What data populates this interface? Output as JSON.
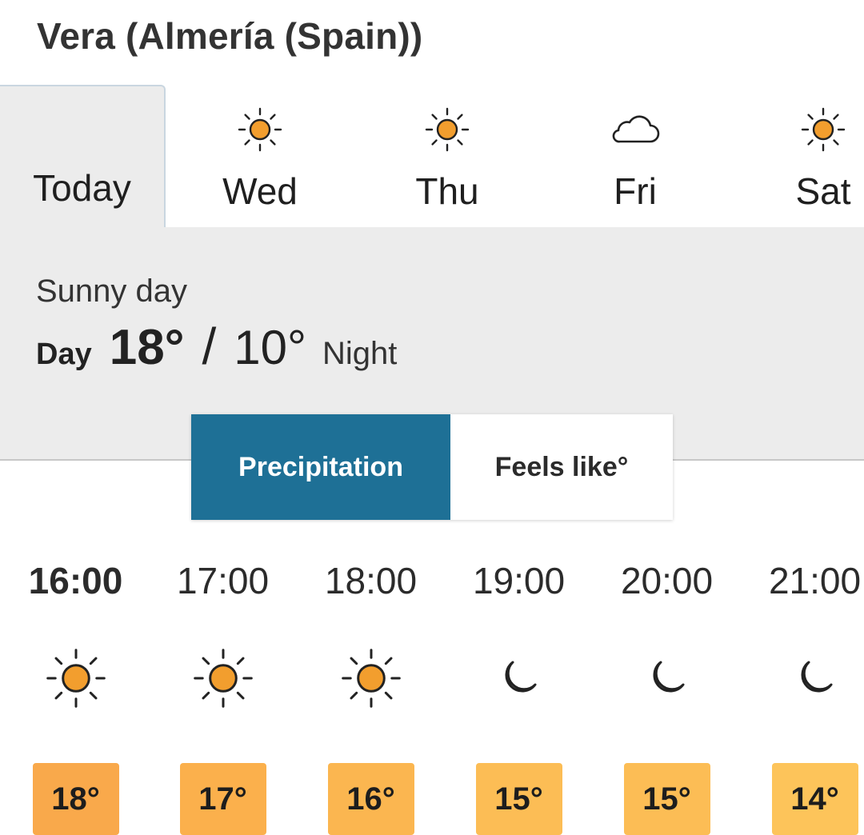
{
  "location": "Vera (Almería (Spain))",
  "tabs": [
    {
      "label": "Today",
      "icon": "none",
      "active": true
    },
    {
      "label": "Wed",
      "icon": "sun-icon",
      "active": false
    },
    {
      "label": "Thu",
      "icon": "sun-icon",
      "active": false
    },
    {
      "label": "Fri",
      "icon": "cloud-icon",
      "active": false
    },
    {
      "label": "Sat",
      "icon": "sun-icon",
      "active": false
    }
  ],
  "summary": {
    "condition": "Sunny day",
    "day_label": "Day",
    "day_temp": "18°",
    "slash": "/",
    "night_temp": "10°",
    "night_label": "Night"
  },
  "toggle": {
    "precipitation": "Precipitation",
    "feels_like": "Feels like°",
    "selected": "precipitation"
  },
  "hours": [
    {
      "time": "16:00",
      "icon": "sun-icon",
      "temp": "18°",
      "badge_color": "#f9a94b",
      "current": true
    },
    {
      "time": "17:00",
      "icon": "sun-icon",
      "temp": "17°",
      "badge_color": "#fbb04c",
      "current": false
    },
    {
      "time": "18:00",
      "icon": "sun-icon",
      "temp": "16°",
      "badge_color": "#fbb650",
      "current": false
    },
    {
      "time": "19:00",
      "icon": "moon-icon",
      "temp": "15°",
      "badge_color": "#fcbd55",
      "current": false
    },
    {
      "time": "20:00",
      "icon": "moon-icon",
      "temp": "15°",
      "badge_color": "#fcbd55",
      "current": false
    },
    {
      "time": "21:00",
      "icon": "moon-icon",
      "temp": "14°",
      "badge_color": "#fdc45a",
      "current": false
    }
  ],
  "colors": {
    "accent": "#1e7096",
    "sun": "#f29e2e",
    "panel": "#ececec"
  }
}
